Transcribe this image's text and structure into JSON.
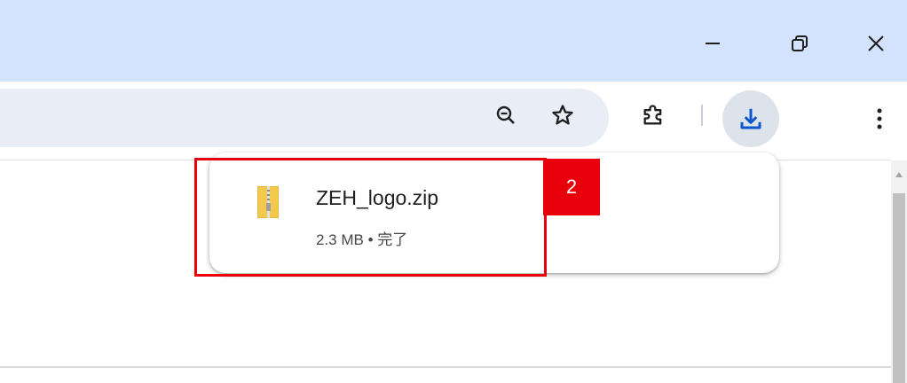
{
  "window_controls": {
    "minimize_icon": "minimize-icon",
    "restore_icon": "restore-icon",
    "close_icon": "close-icon"
  },
  "toolbar": {
    "icons": [
      "zoom-out-icon",
      "bookmark-star-icon",
      "extensions-puzzle-icon",
      "download-icon",
      "more-menu-icon"
    ],
    "accent_color": "#0b57d0"
  },
  "download_popup": {
    "items": [
      {
        "file_name": "ZEH_logo.zip",
        "meta": "2.3 MB • 完了",
        "icon": "zip-file-icon"
      }
    ]
  },
  "annotation": {
    "marker_label": "2",
    "color": "#e8000b"
  }
}
